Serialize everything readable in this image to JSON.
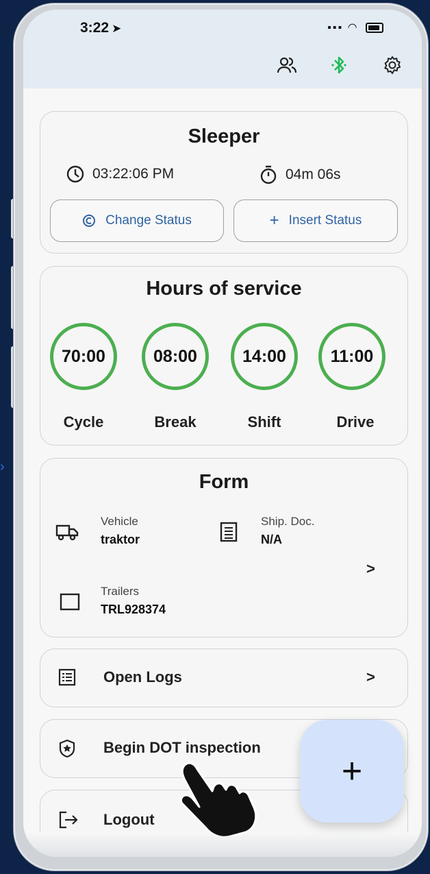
{
  "status_bar": {
    "time": "3:22"
  },
  "sleeper": {
    "title": "Sleeper",
    "clock_time": "03:22:06 PM",
    "elapsed": "04m 06s",
    "change_status_label": "Change Status",
    "insert_status_label": "Insert Status"
  },
  "hos": {
    "title": "Hours of service",
    "items": [
      {
        "value": "70:00",
        "label": "Cycle"
      },
      {
        "value": "08:00",
        "label": "Break"
      },
      {
        "value": "14:00",
        "label": "Shift"
      },
      {
        "value": "11:00",
        "label": "Drive"
      }
    ]
  },
  "form": {
    "title": "Form",
    "vehicle_label": "Vehicle",
    "vehicle_value": "traktor",
    "shipdoc_label": "Ship. Doc.",
    "shipdoc_value": "N/A",
    "trailers_label": "Trailers",
    "trailers_value": "TRL928374"
  },
  "menu": {
    "open_logs": "Open Logs",
    "dot_inspection": "Begin DOT inspection",
    "logout": "Logout"
  },
  "fab_label": "+",
  "colors": {
    "accent_green": "#4caf50",
    "link_blue": "#2f63a3",
    "bluetooth_green": "#1db954",
    "fab_bg": "#d4e3fb"
  }
}
